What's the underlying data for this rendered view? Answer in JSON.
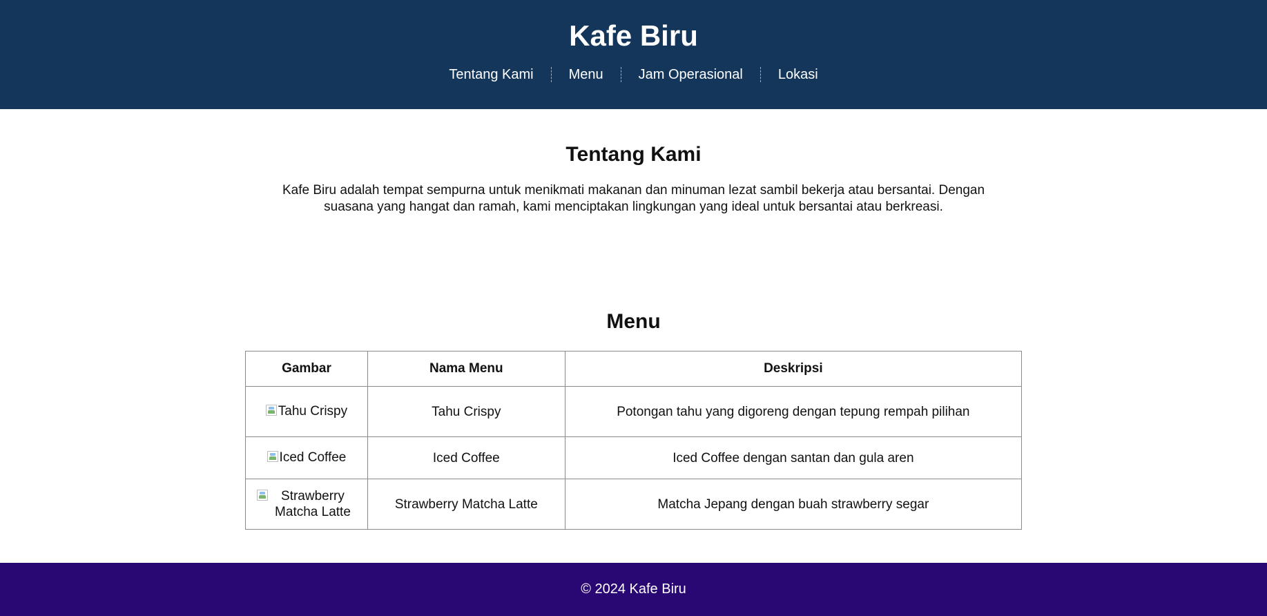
{
  "header": {
    "title": "Kafe Biru",
    "nav": [
      "Tentang Kami",
      "Menu",
      "Jam Operasional",
      "Lokasi"
    ],
    "bg_color": "#14365a"
  },
  "about": {
    "title": "Tentang Kami",
    "text": "Kafe Biru adalah tempat sempurna untuk menikmati makanan dan minuman lezat sambil bekerja atau bersantai. Dengan suasana yang hangat dan ramah, kami menciptakan lingkungan yang ideal untuk bersantai atau berkreasi."
  },
  "menu": {
    "title": "Menu",
    "columns": [
      "Gambar",
      "Nama Menu",
      "Deskripsi"
    ],
    "rows": [
      {
        "image_alt": "Tahu Crispy",
        "name": "Tahu Crispy",
        "description": "Potongan tahu yang digoreng dengan tepung rempah pilihan"
      },
      {
        "image_alt": "Iced Coffee",
        "name": "Iced Coffee",
        "description": "Iced Coffee dengan santan dan gula aren"
      },
      {
        "image_alt": "Strawberry Matcha Latte",
        "name": "Strawberry Matcha Latte",
        "description": "Matcha Jepang dengan buah strawberry segar"
      }
    ]
  },
  "footer": {
    "text": "© 2024 Kafe Biru",
    "bg_color": "#2a0873"
  }
}
